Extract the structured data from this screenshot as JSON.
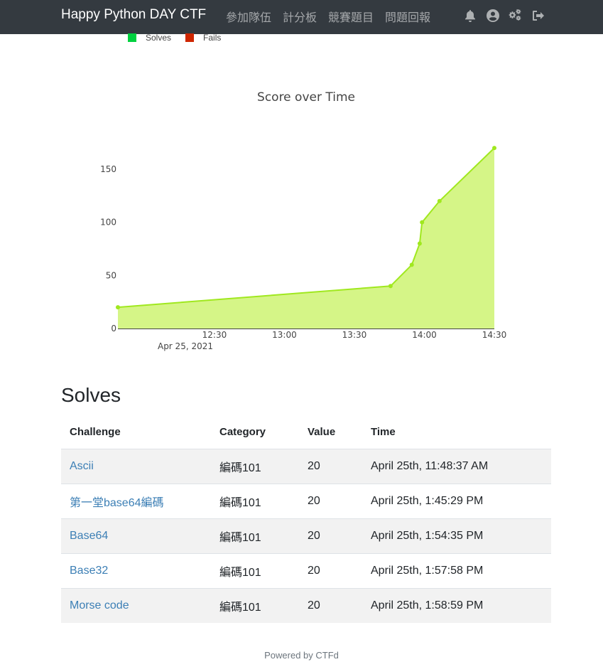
{
  "navbar": {
    "brand": "Happy Python DAY CTF",
    "links": [
      "參加隊伍",
      "計分板",
      "競賽題目",
      "問題回報"
    ],
    "icons": [
      "bell-icon",
      "user-circle-icon",
      "cogs-icon",
      "sign-out-icon"
    ]
  },
  "legend": [
    {
      "label": "Solves",
      "color": "#00d13f"
    },
    {
      "label": "Fails",
      "color": "#cf2600"
    }
  ],
  "chart_data": {
    "type": "area",
    "title": "Score over Time",
    "xlabel": "",
    "ylabel": "",
    "x_date_label": "Apr 25, 2021",
    "x_ticks": [
      "12:30",
      "13:00",
      "13:30",
      "14:00",
      "14:30"
    ],
    "y_ticks": [
      0,
      50,
      100,
      150
    ],
    "ylim": [
      0,
      170
    ],
    "x": [
      "11:48:37",
      "13:45:29",
      "13:54:35",
      "13:57:58",
      "13:58:59",
      "14:06:30",
      "14:40:00"
    ],
    "x_minutes": [
      708.6,
      825.5,
      834.6,
      838.0,
      839.0,
      846.5,
      870
    ],
    "values": [
      20,
      40,
      60,
      80,
      100,
      120,
      170
    ],
    "line_color": "#a0e81f",
    "fill_color": "#d5f587",
    "grid": false
  },
  "solves": {
    "heading": "Solves",
    "columns": [
      "Challenge",
      "Category",
      "Value",
      "Time"
    ],
    "rows": [
      {
        "challenge": "Ascii",
        "category": "編碼101",
        "value": "20",
        "time": "April 25th, 11:48:37 AM"
      },
      {
        "challenge": "第一堂base64編碼",
        "category": "編碼101",
        "value": "20",
        "time": "April 25th, 1:45:29 PM"
      },
      {
        "challenge": "Base64",
        "category": "編碼101",
        "value": "20",
        "time": "April 25th, 1:54:35 PM"
      },
      {
        "challenge": "Base32",
        "category": "編碼101",
        "value": "20",
        "time": "April 25th, 1:57:58 PM"
      },
      {
        "challenge": "Morse code",
        "category": "編碼101",
        "value": "20",
        "time": "April 25th, 1:58:59 PM"
      }
    ]
  },
  "footer": "Powered by CTFd"
}
